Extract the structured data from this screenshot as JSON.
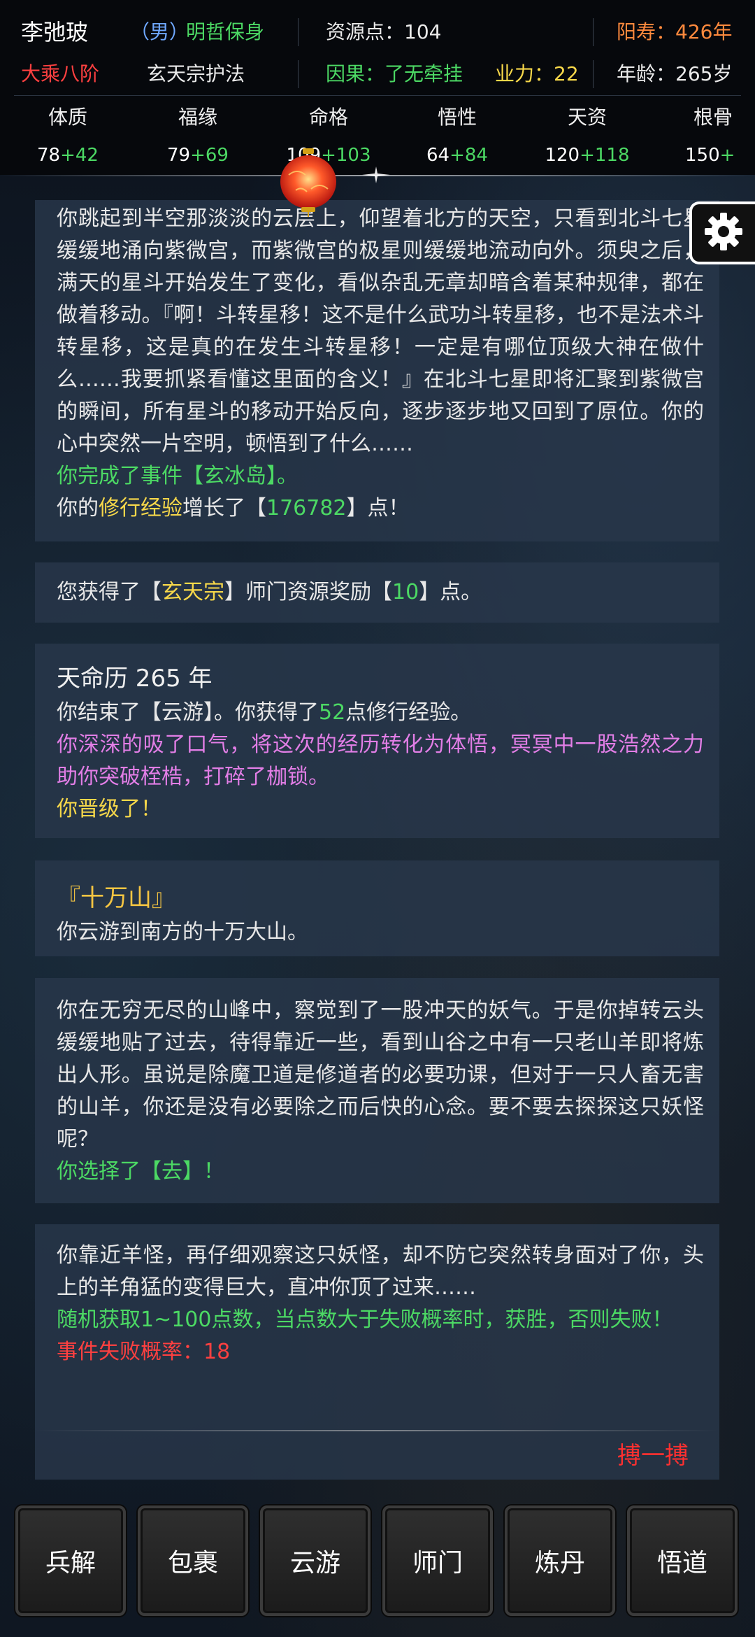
{
  "header": {
    "name": "李弛玻",
    "gender": "（男）",
    "trait": "明哲保身",
    "resource": "资源点：104",
    "lifespan": "阳寿：426年",
    "realm": "大乘八阶",
    "sect_role": "玄天宗护法",
    "karma": "因果：了无牵挂",
    "karma_force": "业力：22",
    "age": "年龄：265岁"
  },
  "stats": [
    {
      "name": "体质",
      "base": "78",
      "bonus": "+42"
    },
    {
      "name": "福缘",
      "base": "79",
      "bonus": "+69"
    },
    {
      "name": "命格",
      "base": "109",
      "bonus": "+103"
    },
    {
      "name": "悟性",
      "base": "64",
      "bonus": "+84"
    },
    {
      "name": "天资",
      "base": "120",
      "bonus": "+118"
    },
    {
      "name": "根骨",
      "base": "150",
      "bonus": "+"
    }
  ],
  "log": {
    "card1": {
      "text": "你跳起到半空那淡淡的云层上，仰望着北方的天空，只看到北斗七星缓缓地涌向紫微宫，而紫微宫的极星则缓缓地流动向外。须臾之后，满天的星斗开始发生了变化，看似杂乱无章却暗含着某种规律，都在做着移动。『啊！斗转星移！这不是什么武功斗转星移，也不是法术斗转星移，这是真的在发生斗转星移！一定是有哪位顶级大神在做什么……我要抓紧看懂这里面的含义！』在北斗七星即将汇聚到紫微宫的瞬间，所有星斗的移动开始反向，逐步逐步地又回到了原位。你的心中突然一片空明，顿悟到了什么……",
      "event": "你完成了事件【玄冰岛】。",
      "exp_pre": "你的",
      "exp_kw": "修行经验",
      "exp_mid": "增长了【",
      "exp_num": "176782",
      "exp_post": "】点！"
    },
    "card2": {
      "pre": "您获得了【",
      "sect": "玄天宗",
      "mid": "】师门资源奖励【",
      "num": "10",
      "post": "】点。"
    },
    "card3": {
      "year": "天命历 265 年",
      "travel_pre": "你结束了【云游】。你获得了",
      "travel_num": "52",
      "travel_post": "点修行经验。",
      "breakthrough": "你深深的吸了口气，将这次的经历转化为体悟，冥冥中一股浩然之力助你突破桎梏，打碎了枷锁。",
      "levelup": "你晋级了！"
    },
    "card4": {
      "title": "『十万山』",
      "text": "你云游到南方的十万大山。"
    },
    "card5": {
      "text": "你在无穷无尽的山峰中，察觉到了一股冲天的妖气。于是你掉转云头缓缓地贴了过去，待得靠近一些，看到山谷之中有一只老山羊即将炼出人形。虽说是除魔卫道是修道者的必要功课，但对于一只人畜无害的山羊，你还是没有必要除之而后快的心念。要不要去探探这只妖怪呢？",
      "choice": "你选择了【去】！"
    },
    "card6": {
      "text": "你靠近羊怪，再仔细观察这只妖怪，却不防它突然转身面对了你，头上的羊角猛的变得巨大，直冲你顶了过来……",
      "rule": "随机获取1~100点数，当点数大于失败概率时，获胜，否则失败！",
      "fail": "事件失败概率：18",
      "action": "搏一搏"
    }
  },
  "nav": [
    "兵解",
    "包裹",
    "云游",
    "师门",
    "炼丹",
    "悟道"
  ],
  "colors": {
    "green": "#4cd964",
    "yellow": "#f7d84a",
    "red": "#ff4040",
    "orange": "#ff8a3d",
    "purple": "#e27ee6",
    "gold": "#f5c542",
    "blue": "#6fa8ff"
  },
  "icons": {
    "settings": "gear-icon",
    "lantern": "lantern-icon",
    "sparkle": "sparkle-icon"
  }
}
